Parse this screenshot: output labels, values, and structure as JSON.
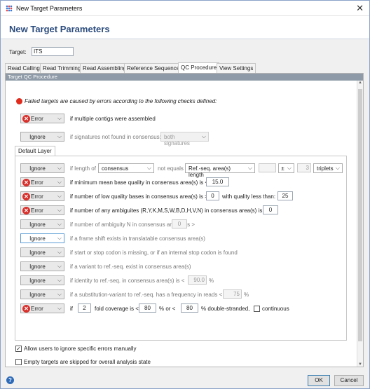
{
  "window": {
    "title": "New Target Parameters",
    "close_glyph": "✕",
    "app_icon": "grid-dots-icon"
  },
  "header": {
    "title": "New Target Parameters"
  },
  "target": {
    "label": "Target:",
    "value": "ITS"
  },
  "tabs": [
    "Read Calling",
    "Read Trimming",
    "Read Assembling",
    "Reference Sequence",
    "QC Procedure",
    "View Settings"
  ],
  "active_tab": "QC Procedure",
  "section": {
    "title": "Target QC Procedure"
  },
  "intro": "Failed targets are caused by errors according to the following checks defined:",
  "top_checks": [
    {
      "level": "Error",
      "text": "if multiple contigs were assembled"
    },
    {
      "level": "Ignore",
      "text": "if signatures not found in consensus:",
      "option": "both signatures"
    }
  ],
  "layer_tab": "Default Layer",
  "checks": {
    "length": {
      "level": "Ignore",
      "prefix": "if length of",
      "field": "consensus",
      "mid": "not equals",
      "ref": "Ref.-seq. area(s) length",
      "value": "",
      "pm": "±",
      "count": "3",
      "unit": "triplets"
    },
    "meanq": {
      "level": "Error",
      "text": "if minimum mean base quality in consensus area(s) is <",
      "value": "15.0"
    },
    "lowq": {
      "level": "Error",
      "text": "if number of low quality bases in consensus area(s) is >",
      "value": "0",
      "mid": "with quality less than:",
      "value2": "25"
    },
    "ambig": {
      "level": "Error",
      "text": "if number of any ambiguites (R,Y,K,M,S,W,B,D,H,V,N) in consensus area(s) is >",
      "value": "0"
    },
    "ambn": {
      "level": "Ignore",
      "text": "if number of ambiguity N in consensus area(s) is >",
      "value": "0"
    },
    "frame": {
      "level": "Ignore",
      "text": "if a frame shift exists in translatable consensus area(s)"
    },
    "stop": {
      "level": "Ignore",
      "text": "if start or stop codon is missing, or if an internal stop codon is found"
    },
    "variant": {
      "level": "Ignore",
      "text": "if a variant to ref.-seq. exist in consensus area(s)"
    },
    "identity": {
      "level": "Ignore",
      "text": "if identity to ref.-seq. in consensus area(s) is <",
      "value": "90.0",
      "unit": "%"
    },
    "subst": {
      "level": "Ignore",
      "text": "if a substitution-variant to ref.-seq. has a frequency in reads <",
      "value": "75",
      "unit": "%"
    },
    "coverage": {
      "level": "Error",
      "t1": "if",
      "v1": "2",
      "t2": "fold coverage is <",
      "v2": "80",
      "t3": "%  or <",
      "v3": "80",
      "t4": "% double-stranded,",
      "cont": "continuous"
    }
  },
  "options": [
    {
      "label": "Allow users to ignore specific errors manually",
      "checked": true
    },
    {
      "label": "Empty targets are skipped for overall analysis state",
      "checked": false
    }
  ],
  "buttons": {
    "ok": "OK",
    "cancel": "Cancel",
    "help": "?"
  },
  "colors": {
    "accent": "#2b4c7e",
    "error": "#d9302c",
    "section": "#8e9aa7"
  }
}
